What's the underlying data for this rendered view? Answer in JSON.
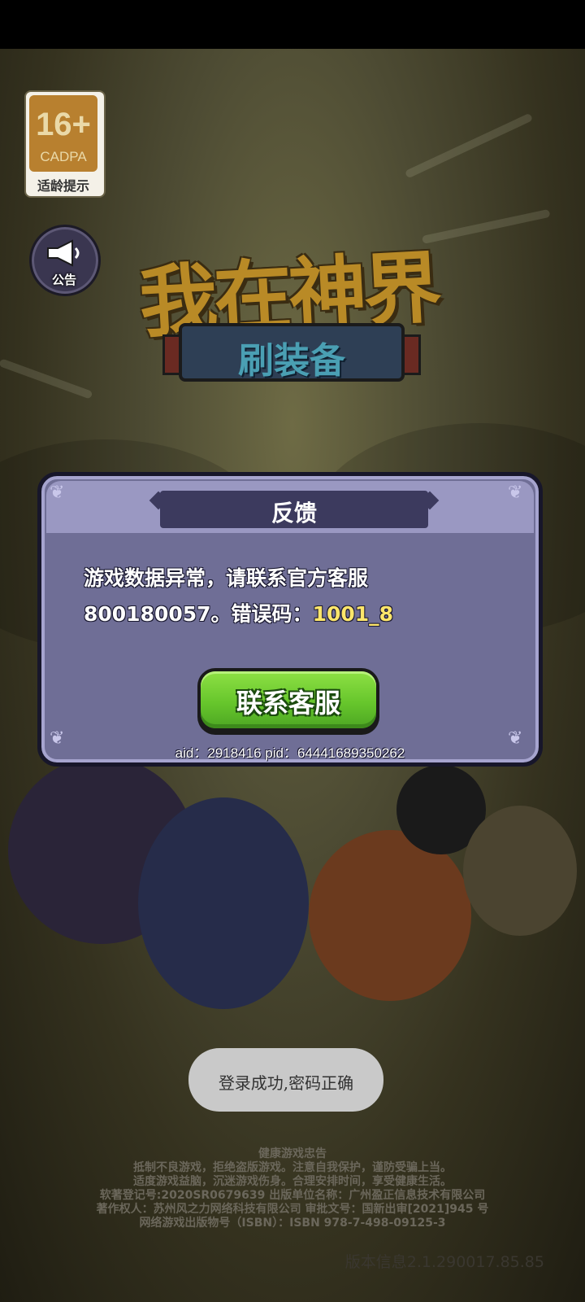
{
  "age_rating": {
    "age": "16+",
    "org": "CADPA",
    "tip": "适龄提示"
  },
  "notice": {
    "label": "公告",
    "icon": "megaphone-icon"
  },
  "logo": {
    "title": "我在神界",
    "subtitle": "刷装备"
  },
  "dialog": {
    "title": "反馈",
    "message_line1": "游戏数据异常，请联系官方客服",
    "message_line2_prefix": "800180057。错误码：",
    "error_code": "1001_8",
    "contact_button": "联系客服",
    "ids": "aid：2918416  pid：64441689350262"
  },
  "toast": {
    "text": "登录成功,密码正确"
  },
  "footer": {
    "line1": "健康游戏忠告",
    "line2": "抵制不良游戏，拒绝盗版游戏。注意自我保护，谨防受骗上当。",
    "line3": "适度游戏益脑，沉迷游戏伤身。合理安排时间，享受健康生活。",
    "line4": "软著登记号:2020SR0679639 出版单位名称：广州盈正信息技术有限公司",
    "line5": "著作权人：苏州风之力网络科技有限公司 审批文号：国新出审[2021]945 号",
    "line6": "网络游戏出版物号（ISBN）：ISBN 978-7-498-09125-3"
  },
  "version": "版本信息2.1.290017.85.85",
  "colors": {
    "dialog_bg": "#6f6e96",
    "button_green": "#67c62c",
    "error_code": "#ffe66b"
  }
}
